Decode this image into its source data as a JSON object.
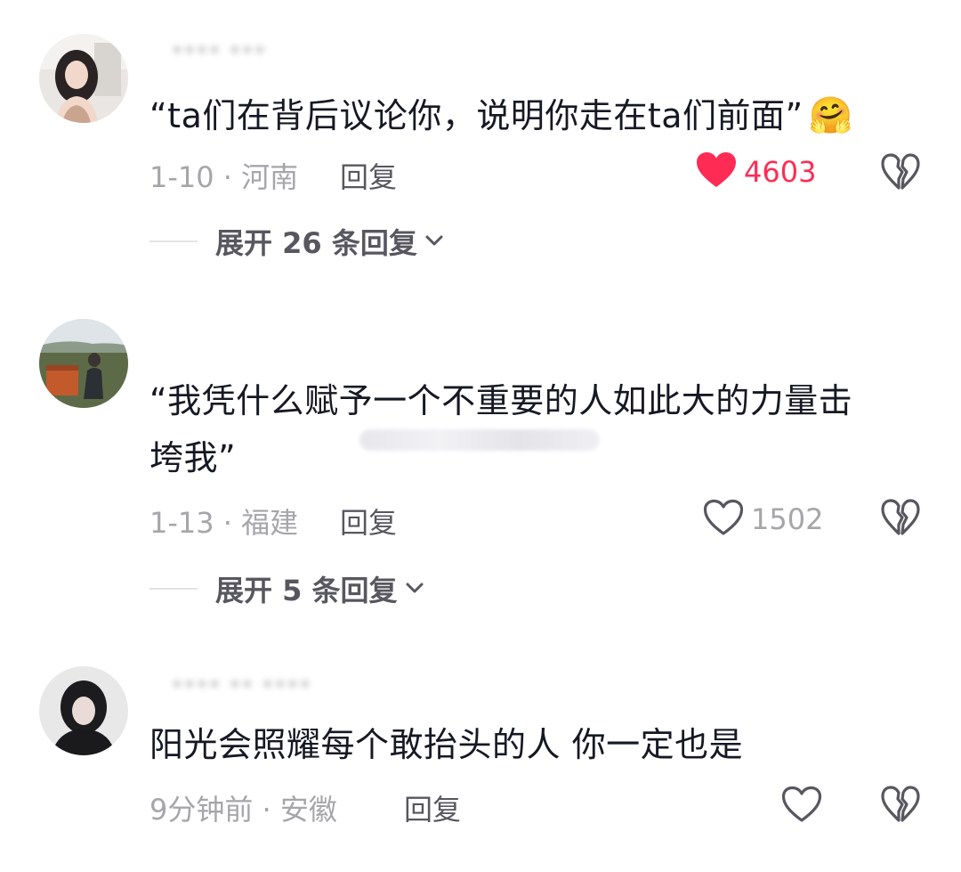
{
  "comments": [
    {
      "username": "**** ***",
      "text": "“ta们在背后议论你，说明你走在ta们前面”",
      "emoji": "🤗",
      "date_location": "1-10 · 河南",
      "reply_label": "回复",
      "likes": "4603",
      "liked": true,
      "expand_label": "展开 26 条回复",
      "icons": {
        "like": "heart-filled-icon",
        "dislike": "broken-heart-icon",
        "expand": "chevron-down-icon"
      },
      "colors": {
        "liked": "#fe2c55"
      }
    },
    {
      "username": "",
      "text_line1": "“我凭什么赋予一个不重要的人如此大的力量击",
      "text_line2": "垮我”",
      "date_location": "1-13 · 福建",
      "reply_label": "回复",
      "likes": "1502",
      "liked": false,
      "expand_label": "展开 5 条回复",
      "icons": {
        "like": "heart-outline-icon",
        "dislike": "broken-heart-icon",
        "expand": "chevron-down-icon"
      }
    },
    {
      "username": "**** ** ****",
      "text": "阳光会照耀每个敢抬头的人 你一定也是",
      "date_location": "9分钟前 · 安徽",
      "reply_label": "回复",
      "likes": "",
      "liked": false,
      "icons": {
        "like": "heart-outline-icon",
        "dislike": "broken-heart-icon"
      }
    }
  ]
}
